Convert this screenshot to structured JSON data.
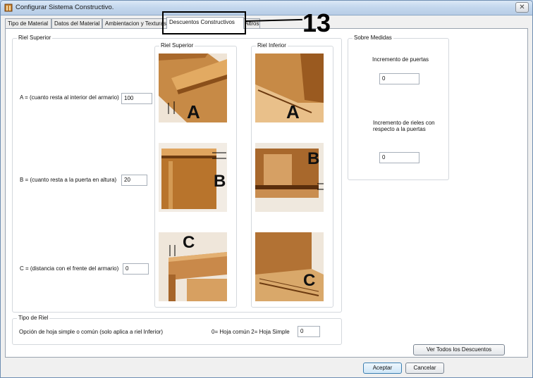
{
  "window": {
    "title": "Configurar Sistema Constructivo.",
    "close_glyph": "✕"
  },
  "tabs": [
    {
      "label": "Tipo de Material"
    },
    {
      "label": "Datos del Material"
    },
    {
      "label": "Ambientacion y Texturas"
    },
    {
      "label": "Descuentos Constructivos"
    },
    {
      "label": "Altros"
    }
  ],
  "annotation": {
    "number": "13"
  },
  "riel_superior_group": {
    "title": "Riel Superior",
    "a_label": "A = (cuanto resta al interior del armario)",
    "a_value": "100",
    "b_label": "B = (cuanto resta a la puerta en altura)",
    "b_value": "20",
    "c_label": "C = (distancia con el frente del armario)",
    "c_value": "0"
  },
  "images_superior": {
    "title": "Riel Superior",
    "letters": [
      "A",
      "B",
      "C"
    ]
  },
  "images_inferior": {
    "title": "Riel Inferior",
    "letters": [
      "A",
      "B",
      "C"
    ]
  },
  "sobre_medidas": {
    "title": "Sobre Medidas",
    "incremento_puertas_label": "Incremento de puertas",
    "incremento_puertas_value": "0",
    "incremento_rieles_label": "Incremento de rieles con respecto a la puertas",
    "incremento_rieles_value": "0"
  },
  "tipo_riel": {
    "title": "Tipo de Riel",
    "option_label": "Opción de hoja simple o común (solo aplica a riel Inferior)",
    "legend_label": "0= Hoja común  2= Hoja Simple",
    "value": "0"
  },
  "buttons": {
    "ver_todos": "Ver Todos los Descuentos",
    "aceptar": "Aceptar",
    "cancelar": "Cancelar"
  },
  "colors": {
    "wood": "#b8742c",
    "wood_dark": "#8a4f1a",
    "wood_light": "#dca15a"
  }
}
